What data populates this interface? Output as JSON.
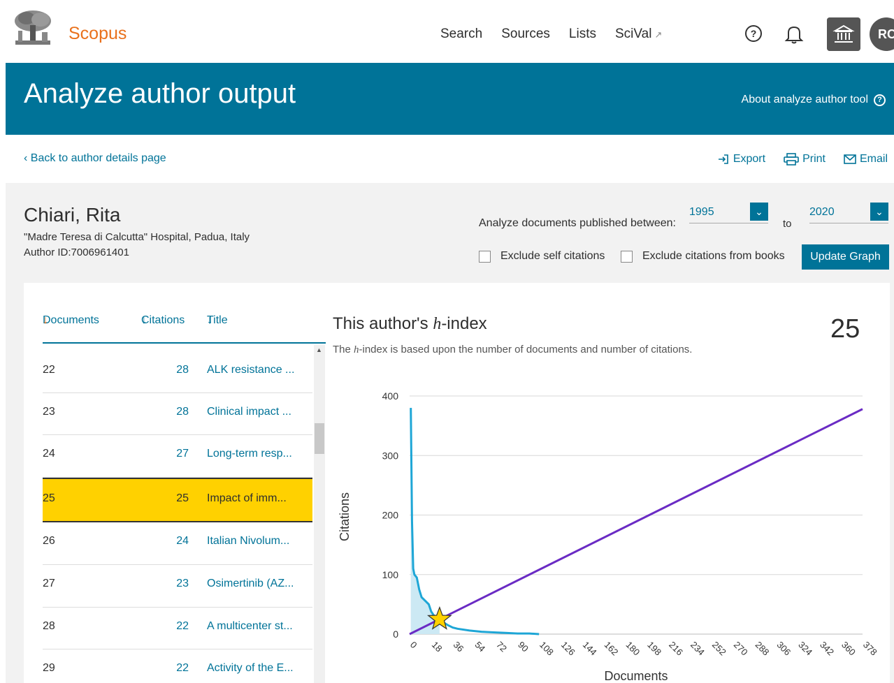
{
  "nav": {
    "brand": "Scopus",
    "links": [
      "Search",
      "Sources",
      "Lists",
      "SciVal"
    ],
    "help_icon": "?",
    "avatar": "RC"
  },
  "banner": {
    "title": "Analyze author output",
    "about": "About analyze author tool"
  },
  "subbar": {
    "back": "‹ Back to author details page",
    "export": "Export",
    "print": "Print",
    "email": "Email"
  },
  "author": {
    "name": "Chiari, Rita",
    "affiliation": "\"Madre Teresa di Calcutta\" Hospital, Padua, Italy",
    "author_id": "Author ID:7006961401"
  },
  "filters": {
    "range_label": "Analyze documents published between:",
    "from": "1995",
    "to_label": "to",
    "to": "2020",
    "exclude_self": "Exclude self citations",
    "exclude_books": "Exclude citations from books",
    "update": "Update Graph"
  },
  "table": {
    "col_documents": "Documents",
    "col_citations": "Citations",
    "col_title": "Title",
    "rows": [
      {
        "doc": "22",
        "cit": "28",
        "title": "ALK resistance ..."
      },
      {
        "doc": "23",
        "cit": "28",
        "title": "Clinical impact ..."
      },
      {
        "doc": "24",
        "cit": "27",
        "title": "Long-term resp..."
      },
      {
        "doc": "25",
        "cit": "25",
        "title": "Impact of imm..."
      },
      {
        "doc": "26",
        "cit": "24",
        "title": "Italian Nivolum..."
      },
      {
        "doc": "27",
        "cit": "23",
        "title": "Osimertinib (AZ..."
      },
      {
        "doc": "28",
        "cit": "22",
        "title": "A multicenter st..."
      },
      {
        "doc": "29",
        "cit": "22",
        "title": "Activity of the E..."
      }
    ],
    "highlight_index": 3
  },
  "hindex": {
    "title_pre": "This author's ",
    "title_h": "h",
    "title_post": "-index",
    "value": "25",
    "sub_pre": "The ",
    "sub_h": "h",
    "sub_post": "-index is based upon the number of documents and number of citations."
  },
  "colors": {
    "accent": "#007398",
    "brand": "#e9711c",
    "highlight": "#ffd100",
    "curve": "#1ea6d6",
    "diagonal": "#6a2bc4",
    "star": "#ffd100"
  },
  "chart_data": {
    "type": "line",
    "xlabel": "Documents",
    "ylabel": "Citations",
    "xlim": [
      0,
      378
    ],
    "ylim": [
      0,
      400
    ],
    "x_ticks": [
      0,
      18,
      36,
      54,
      72,
      90,
      108,
      126,
      144,
      162,
      180,
      198,
      216,
      234,
      252,
      270,
      288,
      306,
      324,
      342,
      360,
      378
    ],
    "y_ticks": [
      0,
      100,
      200,
      300,
      400
    ],
    "h_index": 25,
    "grid": true,
    "series": [
      {
        "x": [
          1,
          2,
          3,
          4,
          6,
          8,
          10,
          12,
          14,
          16,
          18,
          20,
          22,
          24,
          25,
          28,
          32,
          36,
          40,
          50,
          60,
          70,
          80,
          90,
          100,
          108
        ],
        "values": [
          380,
          190,
          110,
          100,
          95,
          75,
          62,
          58,
          54,
          50,
          38,
          32,
          28,
          27,
          25,
          20,
          15,
          11,
          9,
          6,
          4,
          3,
          2,
          1,
          1,
          0
        ]
      },
      {
        "x": [
          0,
          378
        ],
        "values": [
          0,
          378
        ]
      }
    ]
  }
}
